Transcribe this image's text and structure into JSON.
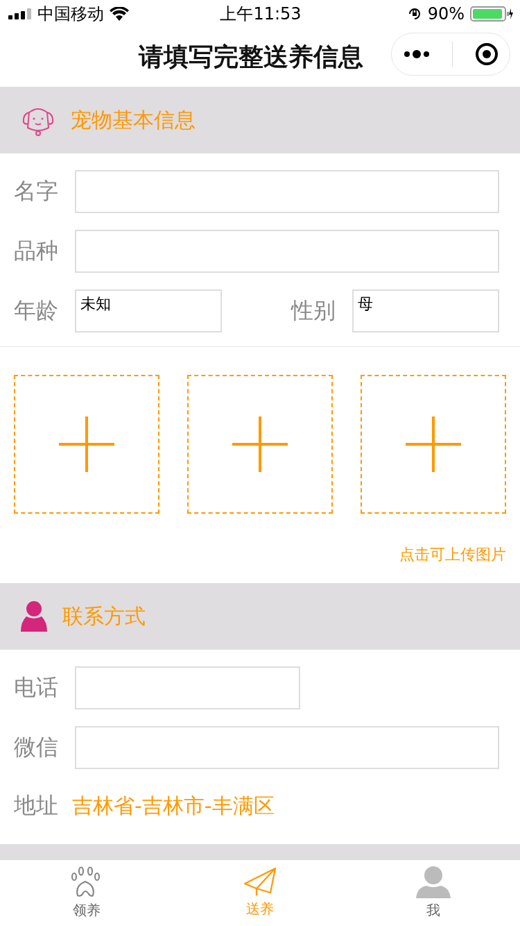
{
  "status_bar": {
    "carrier": "中国移动",
    "time": "上午11:53",
    "battery": "90%"
  },
  "nav": {
    "title": "请填写完整送养信息"
  },
  "pet_section": {
    "title": "宠物基本信息",
    "fields": [
      {
        "label": "名字"
      },
      {
        "label": "品种"
      }
    ],
    "pair": [
      {
        "label": "年龄",
        "value": "未知"
      },
      {
        "label": "性别",
        "value": "母"
      }
    ],
    "upload_slots": [
      {
        "kind": "add"
      },
      {
        "kind": "add"
      },
      {
        "kind": "add"
      }
    ],
    "upload_hint": "点击可上传图片"
  },
  "contact_section": {
    "title": "联系方式",
    "fields": [
      {
        "label": "电话",
        "kind": "short"
      },
      {
        "label": "微信",
        "kind": "wide"
      }
    ],
    "address": {
      "label": "地址",
      "value": "吉林省-吉林市-丰满区"
    }
  },
  "tabs": [
    {
      "label": "领养",
      "selected": false,
      "kind": "paw"
    },
    {
      "label": "送养",
      "selected": true,
      "kind": "plane"
    },
    {
      "label": "我",
      "selected": false,
      "kind": "person"
    }
  ]
}
